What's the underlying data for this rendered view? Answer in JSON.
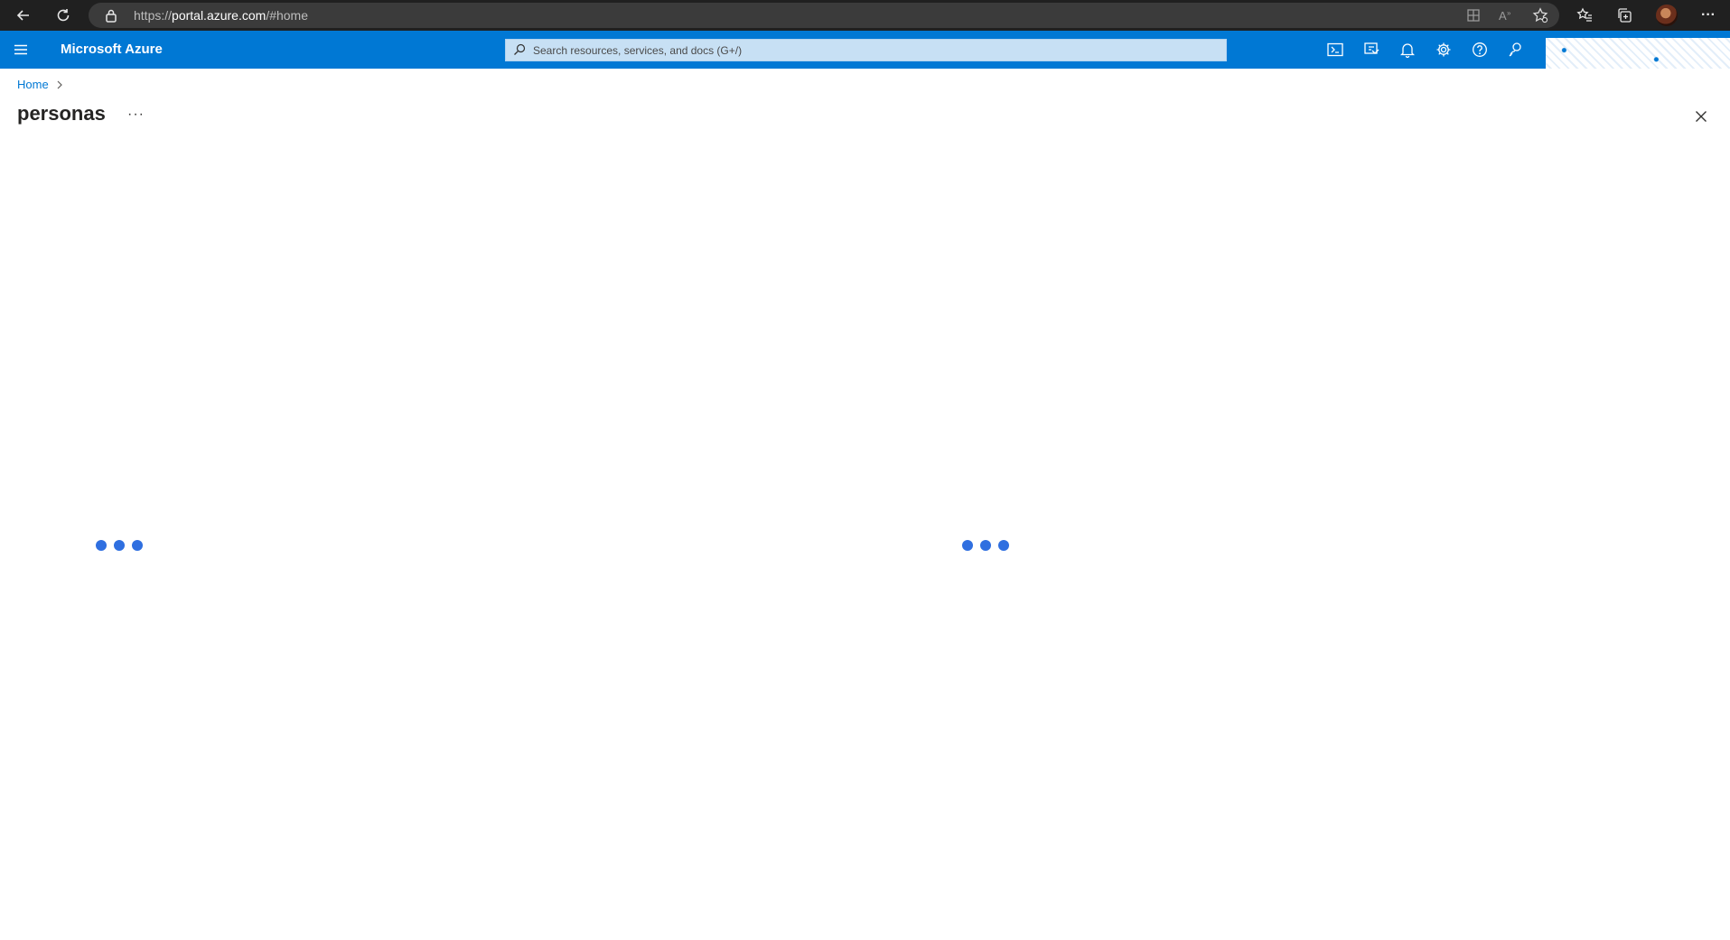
{
  "browser": {
    "url_prefix": "https://",
    "url_host": "portal.azure.com",
    "url_path": "/#home",
    "more_label": "···"
  },
  "header": {
    "brand": "Microsoft Azure",
    "search_placeholder": "Search resources, services, and docs (G+/)"
  },
  "breadcrumb": {
    "home": "Home"
  },
  "page": {
    "title": "personas",
    "more_label": "···"
  },
  "colors": {
    "azure_blue": "#0078d4",
    "search_bg": "#c7e0f4",
    "loader_dot": "#2f6fe0"
  }
}
